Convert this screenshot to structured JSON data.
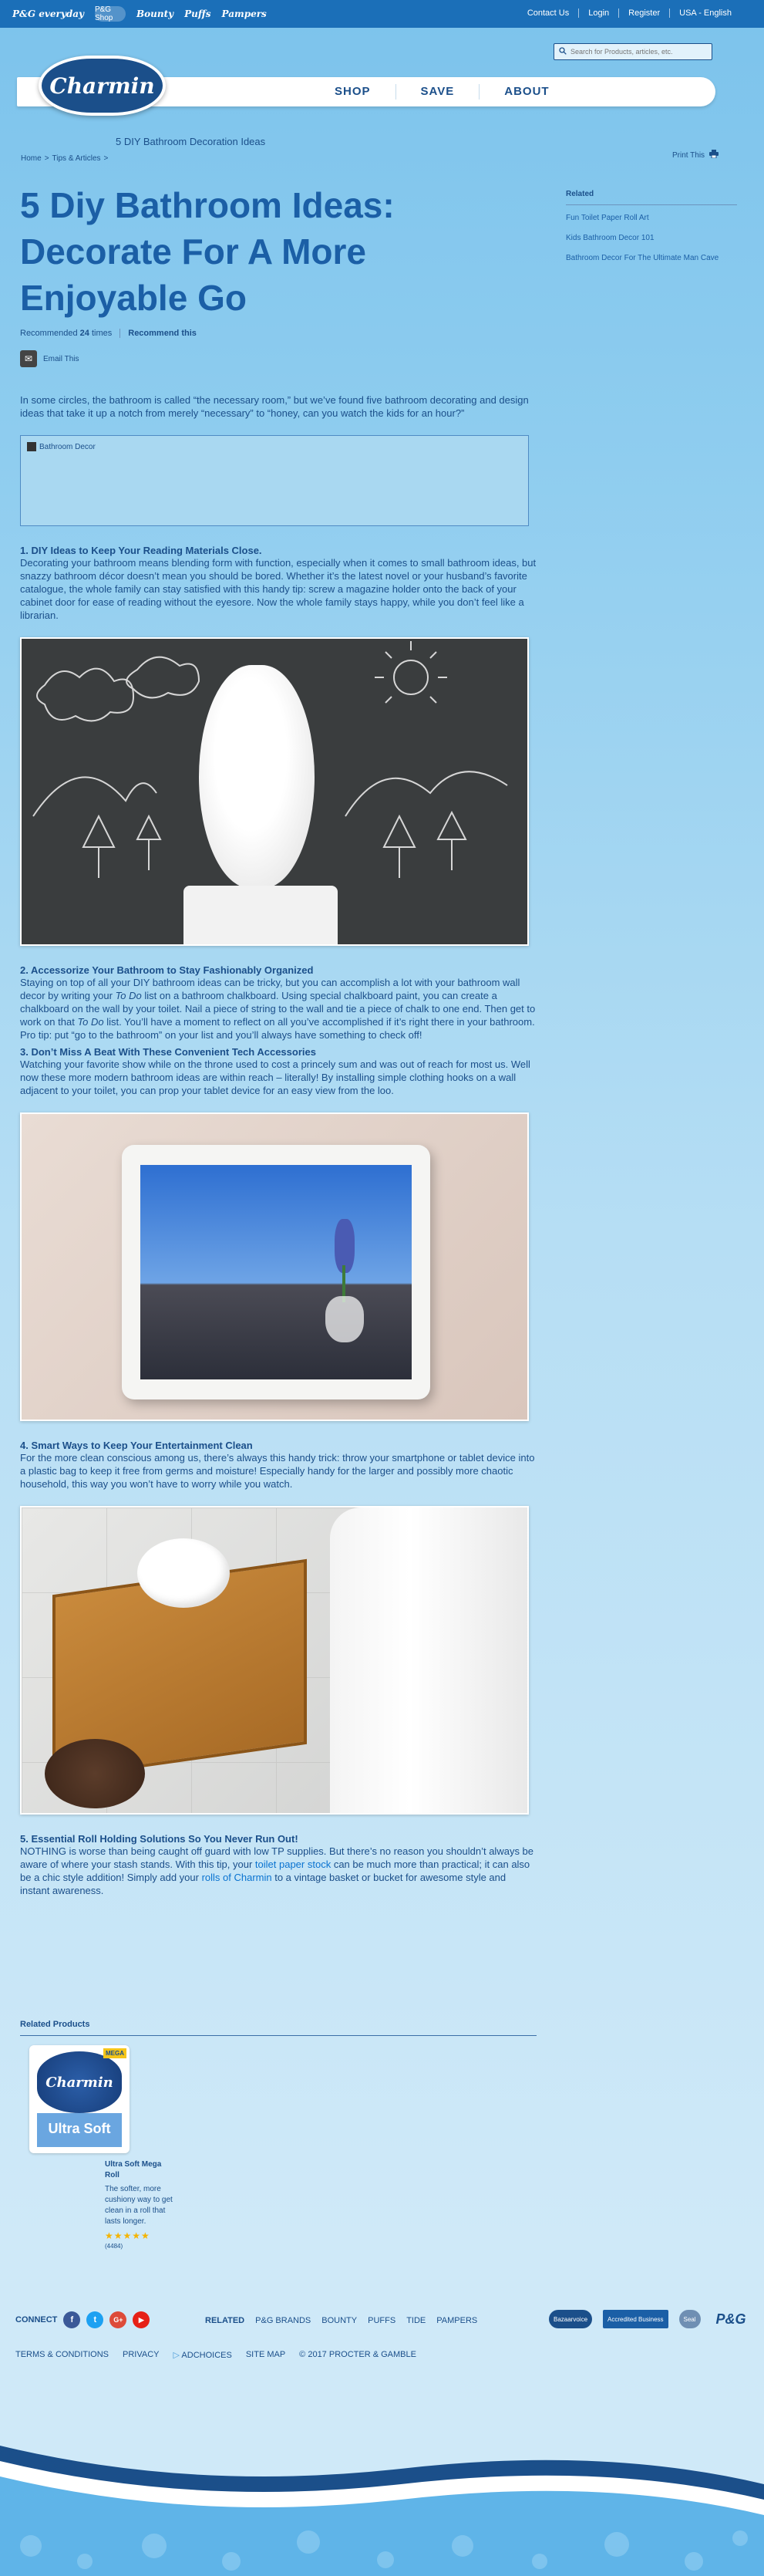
{
  "topbar": {
    "brands": [
      "P&G everyday",
      "P&G Shop",
      "Bounty",
      "Puffs",
      "Pampers"
    ],
    "links": [
      "Contact Us",
      "Login",
      "Register",
      "USA - English"
    ]
  },
  "header": {
    "logo_text": "Charmin",
    "search_placeholder": "Search for Products, articles, etc.",
    "nav": [
      "SHOP",
      "SAVE",
      "ABOUT"
    ],
    "section_title": "5 DIY Bathroom Decoration Ideas"
  },
  "breadcrumb": [
    "Home",
    ">",
    "Tips & Articles",
    ">"
  ],
  "print_label": "Print This",
  "article": {
    "title": "5 Diy Bathroom Ideas: Decorate For A More Enjoyable Go",
    "recommended_prefix": "Recommended",
    "recommended_count": "24",
    "recommended_suffix": "times",
    "recommend_link": "Recommend this",
    "email_label": "Email This",
    "intro": "In some circles, the bathroom is called “the necessary room,” but we’ve found five bathroom decorating and design ideas that take it up a notch from merely “necessary” to “honey, can you watch the kids for an hour?”",
    "video_label": "Bathroom Decor",
    "sections": [
      {
        "heading": "1. DIY Ideas to Keep Your Reading Materials Close.",
        "body": "Decorating your bathroom means blending form with function, especially when it comes to small bathroom ideas, but snazzy bathroom décor doesn’t mean you should be bored. Whether it’s the latest novel or your husband’s favorite catalogue, the whole family can stay satisfied with this handy tip: screw a magazine holder onto the back of your cabinet door for ease of reading without the eyesore. Now the whole family stays happy, while you don’t feel like a librarian."
      },
      {
        "heading": "2. Accessorize Your Bathroom to Stay Fashionably Organized",
        "body_a": "Staying on top of all your DIY bathroom ideas can be tricky, but you can accomplish a lot with your bathroom wall decor by writing your ",
        "em_a": "To Do",
        "body_b": " list on a bathroom chalkboard. Using special chalkboard paint, you can create a chalkboard on the wall by your toilet. Nail a piece of string to the wall and tie a piece of chalk to one end. Then get to work on that ",
        "em_b": "To Do",
        "body_c": " list. You’ll have a moment to reflect on all you’ve accomplished if it’s right there in your bathroom. Pro tip: put “go to the bathroom” on your list and you’ll always have something to check off!"
      },
      {
        "heading": "3. Don’t Miss A Beat With These Convenient Tech Accessories",
        "body": "Watching your favorite show while on the throne used to cost a princely sum and was out of reach for most us. Well now these more modern bathroom ideas are within reach – literally! By installing simple clothing hooks on a wall adjacent to your toilet, you can prop your tablet device for an easy view from the loo."
      },
      {
        "heading": "4. Smart Ways to Keep Your Entertainment Clean",
        "body": "For the more clean conscious among us, there’s always this handy trick: throw your smartphone or tablet device into a plastic bag to keep it free from germs and moisture! Especially handy for the larger and possibly more chaotic household, this way you won’t have to worry while you watch."
      },
      {
        "heading": "5. Essential Roll Holding Solutions So You Never Run Out!",
        "body_a": "NOTHING is worse than being caught off guard with low TP supplies. But there’s no reason you shouldn’t always be aware of where your stash stands. With this tip, your ",
        "link_a": "toilet paper stock",
        "body_b": " can be much more than practical; it can also be a chic style addition! Simply add your ",
        "link_b": "rolls of Charmin",
        "body_c": " to a vintage basket or bucket for awesome style and instant awareness."
      }
    ]
  },
  "sidebar": {
    "heading": "Related",
    "items": [
      "Fun Toilet Paper Roll Art",
      "Kids Bathroom Decor 101",
      "Bathroom Decor For The Ultimate Man Cave"
    ]
  },
  "related_products": {
    "heading": "Related Products",
    "product": {
      "package_logo": "Charmin",
      "package_line": "Ultra Soft",
      "package_badge": "MEGA",
      "name": "Ultra Soft Mega Roll",
      "description": "The softer, more cushiony way to get clean in a roll that lasts longer.",
      "stars": "★★★★★",
      "reviews": "(4484)"
    }
  },
  "footer": {
    "connect_label": "CONNECT",
    "social": [
      "f",
      "t",
      "G+",
      "▶"
    ],
    "related_heading": "RELATED",
    "related_links": [
      "P&G BRANDS",
      "BOUNTY",
      "PUFFS",
      "TIDE",
      "PAMPERS"
    ],
    "links": [
      "TERMS & CONDITIONS",
      "PRIVACY",
      "ADCHOICES",
      "SITE MAP",
      "© 2017 PROCTER & GAMBLE"
    ],
    "logos": [
      "Bazaarvoice",
      "Accredited Business",
      "Seal",
      "P&G"
    ]
  },
  "colors": {
    "brand_blue": "#1b4f8a",
    "topbar_blue": "#1b6fb8",
    "link_blue": "#0a73d0",
    "facebook": "#3b5998",
    "twitter": "#1da1f2",
    "google": "#dd4b39",
    "youtube": "#e62117"
  }
}
